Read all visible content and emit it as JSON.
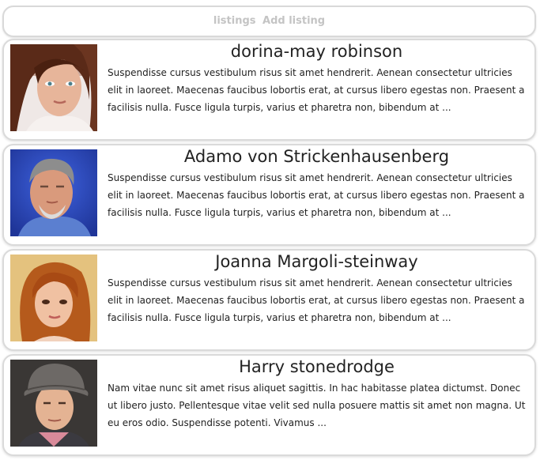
{
  "nav": {
    "listings_label": "listings",
    "add_listing_label": "Add listing"
  },
  "listings": [
    {
      "name": "dorina-may robinson",
      "description": "Suspendisse cursus vestibulum risus sit amet hendrerit. Aenean consectetur ultricies elit in laoreet. Maecenas faucibus lobortis erat, at cursus libero egestas non. Praesent a facilisis nulla. Fusce ligula turpis, varius et pharetra non, bibendum at ..."
    },
    {
      "name": "Adamo von Strickenhausenberg",
      "description": "Suspendisse cursus vestibulum risus sit amet hendrerit. Aenean consectetur ultricies elit in laoreet. Maecenas faucibus lobortis erat, at cursus libero egestas non. Praesent a facilisis nulla. Fusce ligula turpis, varius et pharetra non, bibendum at ..."
    },
    {
      "name": "Joanna Margoli-steinway",
      "description": "Suspendisse cursus vestibulum risus sit amet hendrerit. Aenean consectetur ultricies elit in laoreet. Maecenas faucibus lobortis erat, at cursus libero egestas non. Praesent a facilisis nulla. Fusce ligula turpis, varius et pharetra non, bibendum at ..."
    },
    {
      "name": "Harry stonedrodge",
      "description": "Nam vitae nunc sit amet risus aliquet sagittis. In hac habitasse platea dictumst. Donec ut libero justo. Pellentesque vitae velit sed nulla posuere mattis sit amet non magna. Ut eu eros odio. Suspendisse potenti. Vivamus ..."
    }
  ]
}
